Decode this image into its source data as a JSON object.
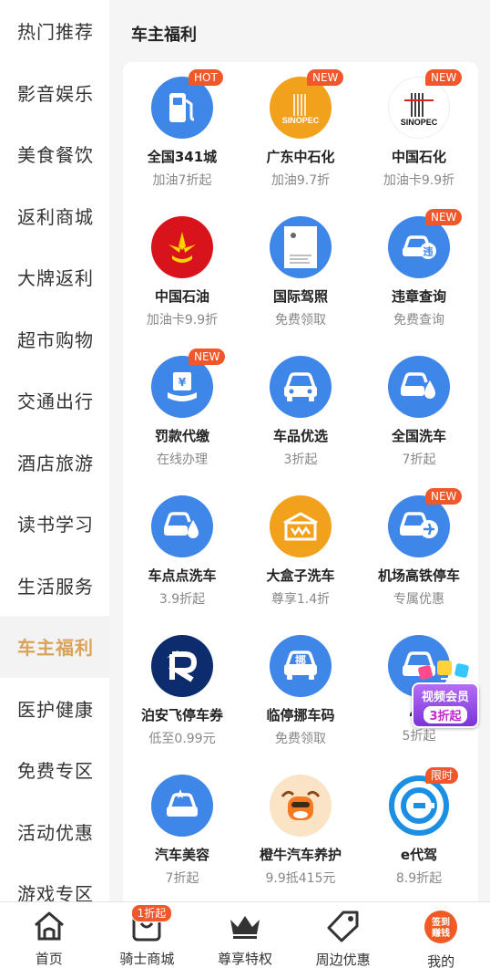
{
  "sidebar": {
    "items": [
      {
        "label": "热门推荐"
      },
      {
        "label": "影音娱乐"
      },
      {
        "label": "美食餐饮"
      },
      {
        "label": "返利商城"
      },
      {
        "label": "大牌返利"
      },
      {
        "label": "超市购物"
      },
      {
        "label": "交通出行"
      },
      {
        "label": "酒店旅游"
      },
      {
        "label": "读书学习"
      },
      {
        "label": "生活服务"
      },
      {
        "label": "车主福利",
        "active": true
      },
      {
        "label": "医护健康"
      },
      {
        "label": "免费专区"
      },
      {
        "label": "活动优惠"
      },
      {
        "label": "游戏专区"
      }
    ]
  },
  "main": {
    "section_title": "车主福利",
    "items": [
      {
        "title": "全国341城",
        "sub": "加油7折起",
        "badge": "HOT",
        "icon": "fuel-pump-icon"
      },
      {
        "title": "广东中石化",
        "sub": "加油9.7折",
        "badge": "NEW",
        "icon": "sinopec-logo-icon"
      },
      {
        "title": "中国石化",
        "sub": "加油卡9.9折",
        "badge": "NEW",
        "icon": "sinopec-logo-icon"
      },
      {
        "title": "中国石油",
        "sub": "加油卡9.9折",
        "badge": "",
        "icon": "petrochina-logo-icon"
      },
      {
        "title": "国际驾照",
        "sub": "免费领取",
        "badge": "",
        "icon": "license-document-icon"
      },
      {
        "title": "违章查询",
        "sub": "免费查询",
        "badge": "NEW",
        "icon": "car-violation-icon"
      },
      {
        "title": "罚款代缴",
        "sub": "在线办理",
        "badge": "NEW",
        "icon": "fine-payment-icon"
      },
      {
        "title": "车品优选",
        "sub": "3折起",
        "badge": "",
        "icon": "car-icon"
      },
      {
        "title": "全国洗车",
        "sub": "7折起",
        "badge": "",
        "icon": "car-wash-icon"
      },
      {
        "title": "车点点洗车",
        "sub": "3.9折起",
        "badge": "",
        "icon": "car-wash-icon"
      },
      {
        "title": "大盒子洗车",
        "sub": "尊享1.4折",
        "badge": "",
        "icon": "big-box-logo-icon"
      },
      {
        "title": "机场高铁停车",
        "sub": "专属优惠",
        "badge": "NEW",
        "icon": "airport-parking-icon"
      },
      {
        "title": "泊安飞停车券",
        "sub": "低至0.99元",
        "badge": "",
        "icon": "boanfei-logo-icon"
      },
      {
        "title": "临停挪车码",
        "sub": "免费领取",
        "badge": "",
        "icon": "move-car-code-icon"
      },
      {
        "title": "4S",
        "sub": "5折起",
        "badge": "",
        "icon": "car-icon"
      },
      {
        "title": "汽车美容",
        "sub": "7折起",
        "badge": "",
        "icon": "car-beauty-icon"
      },
      {
        "title": "橙牛汽车养护",
        "sub": "9.9抵415元",
        "badge": "",
        "icon": "orange-cow-icon"
      },
      {
        "title": "e代驾",
        "sub": "8.9折起",
        "badge": "限时",
        "icon": "e-driver-logo-icon"
      }
    ]
  },
  "vip_float": {
    "line1": "视频会员",
    "line2": "3折起"
  },
  "bottom_nav": {
    "items": [
      {
        "label": "首页",
        "icon": "home-icon"
      },
      {
        "label": "骑士商城",
        "icon": "shop-icon",
        "badge": "1折起"
      },
      {
        "label": "尊享特权",
        "icon": "crown-icon"
      },
      {
        "label": "周边优惠",
        "icon": "tag-icon"
      },
      {
        "label": "我的",
        "icon": "checkin-icon",
        "icon_text": "签到赚钱"
      }
    ]
  },
  "colors": {
    "accent": "#d9a35a",
    "blue_icon": "#3e86e8",
    "orange_icon": "#f2a11d",
    "badge_red": "#f0572a"
  }
}
